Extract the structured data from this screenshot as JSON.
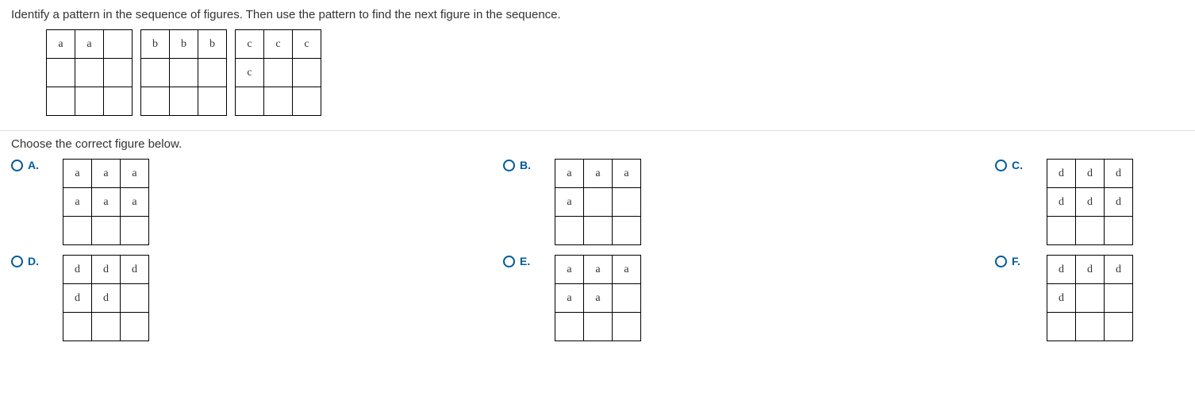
{
  "question": {
    "text": "Identify a pattern in the sequence of figures.  Then use the pattern to find the next figure in the sequence.",
    "sequence": [
      {
        "cells": [
          [
            "a",
            "a",
            ""
          ],
          [
            "",
            "",
            ""
          ],
          [
            "",
            "",
            ""
          ]
        ]
      },
      {
        "cells": [
          [
            "b",
            "b",
            "b"
          ],
          [
            "",
            "",
            ""
          ],
          [
            "",
            "",
            ""
          ]
        ]
      },
      {
        "cells": [
          [
            "c",
            "c",
            "c"
          ],
          [
            "c",
            "",
            ""
          ],
          [
            "",
            "",
            ""
          ]
        ]
      }
    ]
  },
  "answerPrompt": "Choose the correct figure below.",
  "options": {
    "A": {
      "label": "A.",
      "cells": [
        [
          "a",
          "a",
          "a"
        ],
        [
          "a",
          "a",
          "a"
        ],
        [
          "",
          "",
          ""
        ]
      ]
    },
    "B": {
      "label": "B.",
      "cells": [
        [
          "a",
          "a",
          "a"
        ],
        [
          "a",
          "",
          ""
        ],
        [
          "",
          "",
          ""
        ]
      ]
    },
    "C": {
      "label": "C.",
      "cells": [
        [
          "d",
          "d",
          "d"
        ],
        [
          "d",
          "d",
          "d"
        ],
        [
          "",
          "",
          ""
        ]
      ]
    },
    "D": {
      "label": "D.",
      "cells": [
        [
          "d",
          "d",
          "d"
        ],
        [
          "d",
          "d",
          ""
        ],
        [
          "",
          "",
          ""
        ]
      ]
    },
    "E": {
      "label": "E.",
      "cells": [
        [
          "a",
          "a",
          "a"
        ],
        [
          "a",
          "a",
          ""
        ],
        [
          "",
          "",
          ""
        ]
      ]
    },
    "F": {
      "label": "F.",
      "cells": [
        [
          "d",
          "d",
          "d"
        ],
        [
          "d",
          "",
          ""
        ],
        [
          "",
          "",
          ""
        ]
      ]
    }
  }
}
